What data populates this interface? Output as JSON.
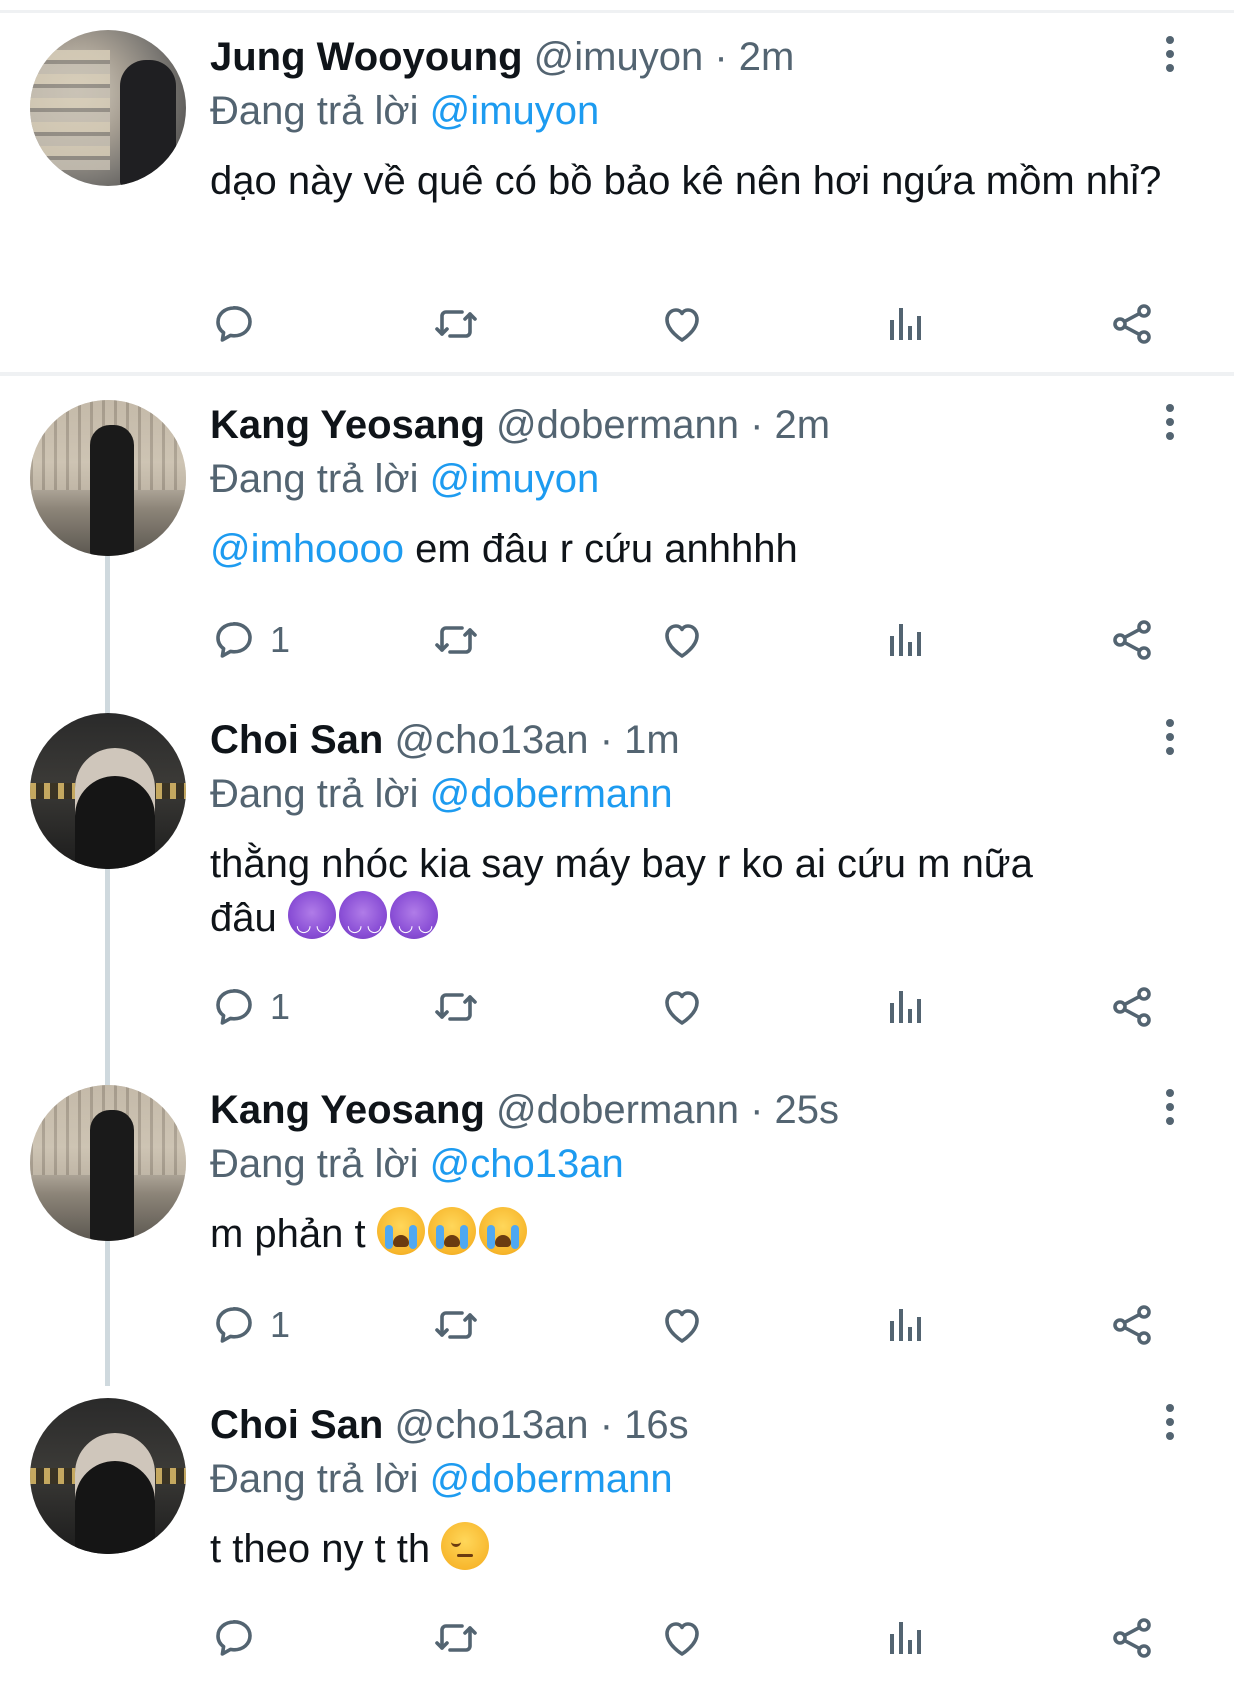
{
  "colors": {
    "accent": "#1d9bf0",
    "secondary_text": "#536471",
    "primary_text": "#0f1419",
    "thread_line": "#cfd9de"
  },
  "tweets": [
    {
      "name": "Jung Wooyoung",
      "handle": "@imuyon",
      "time": "· 2m",
      "replying_label": "Đang trả lời",
      "replying_to": "@imuyon",
      "text": "dạo này về quê có bồ bảo kê nên hơi ngứa mồm nhỉ?",
      "reply_count": ""
    },
    {
      "name": "Kang Yeosang",
      "handle": "@dobermann",
      "time": "· 2m",
      "replying_label": "Đang trả lời",
      "replying_to": "@imuyon",
      "mention": "@imhoooo",
      "text": "em đâu r cứu anhhhh",
      "reply_count": "1"
    },
    {
      "name": "Choi San",
      "handle": "@cho13an",
      "time": "· 1m",
      "replying_label": "Đang trả lời",
      "replying_to": "@dobermann",
      "text_line1": "thằng nhóc kia say máy bay r ko ai cứu m nữa",
      "text_line2": "đâu",
      "emojis": [
        "smiling-face-with-horns",
        "smiling-face-with-horns",
        "smiling-face-with-horns"
      ],
      "reply_count": "1"
    },
    {
      "name": "Kang Yeosang",
      "handle": "@dobermann",
      "time": "· 25s",
      "replying_label": "Đang trả lời",
      "replying_to": "@cho13an",
      "text": "m phản t",
      "emojis": [
        "loudly-crying-face",
        "loudly-crying-face",
        "loudly-crying-face"
      ],
      "reply_count": "1"
    },
    {
      "name": "Choi San",
      "handle": "@cho13an",
      "time": "· 16s",
      "replying_label": "Đang trả lời",
      "replying_to": "@dobermann",
      "text": "t theo ny t th",
      "emojis": [
        "pensive-face"
      ],
      "reply_count": ""
    }
  ]
}
